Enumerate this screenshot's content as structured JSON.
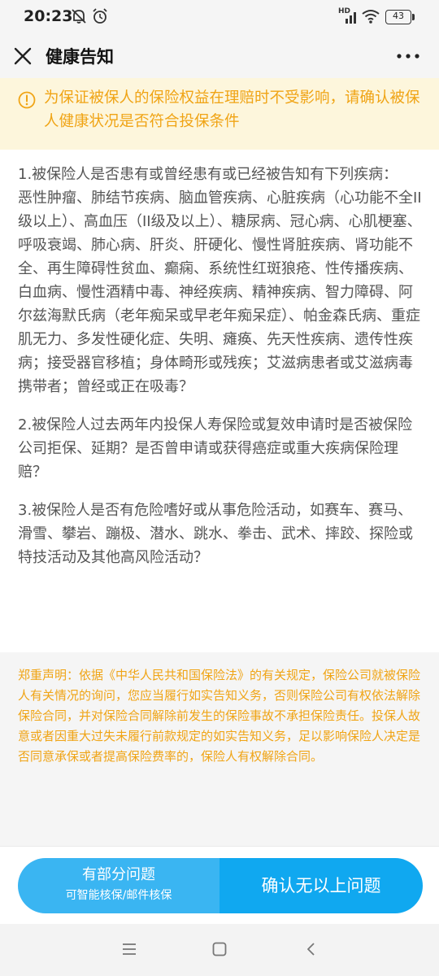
{
  "status_bar": {
    "time": "20:23",
    "network": "HD",
    "battery": "43",
    "icons": [
      "mute-bell-icon",
      "alarm-icon",
      "signal-icon",
      "wifi-icon",
      "battery-icon"
    ]
  },
  "title_bar": {
    "title": "健康告知",
    "close_icon": "close-icon",
    "more_icon": "more-icon"
  },
  "warning": {
    "icon": "warning-icon",
    "text": "为保证被保人的保险权益在理赔时不受影响，请确认被保人健康状况是否符合投保条件"
  },
  "questions": [
    {
      "title": "1.被保险人是否患有或曾经患有或已经被告知有下列疾病：",
      "body": "恶性肿瘤、肺结节疾病、脑血管疾病、心脏疾病（心功能不全II级以上）、高血压（II级及以上）、糖尿病、冠心病、心肌梗塞、呼吸衰竭、肺心病、肝炎、肝硬化、慢性肾脏疾病、肾功能不全、再生障碍性贫血、癫痫、系统性红斑狼疮、性传播疾病、白血病、慢性酒精中毒、神经疾病、精神疾病、智力障碍、阿尔兹海默氏病（老年痴呆或早老年痴呆症）、帕金森氏病、重症肌无力、多发性硬化症、失明、瘫痪、先天性疾病、遗传性疾病；接受器官移植；身体畸形或残疾；艾滋病患者或艾滋病毒携带者；曾经或正在吸毒？"
    },
    {
      "title": "2.被保险人过去两年内投保人寿保险或复效申请时是否被保险公司拒保、延期？是否曾申请或获得癌症或重大疾病保险理赔？",
      "body": ""
    },
    {
      "title": "3.被保险人是否有危险嗜好或从事危险活动，如赛车、赛马、滑雪、攀岩、蹦极、潜水、跳水、拳击、武术、摔跤、探险或特技活动及其他高风险活动？",
      "body": ""
    }
  ],
  "declaration": "郑重声明：依据《中华人民共和国保险法》的有关规定，保险公司就被保险人有关情况的询问，您应当履行如实告知义务，否则保险公司有权依法解除保险合同，并对保险合同解除前发生的保险事故不承担保险责任。投保人故意或者因重大过失未履行前款规定的如实告知义务，足以影响保险人决定是否同意承保或者提高保险费率的，保险人有权解除合同。",
  "actions": {
    "partial_label": "有部分问题",
    "partial_sublabel": "可智能核保/邮件核保",
    "confirm_label": "确认无以上问题"
  },
  "nav_bar": {
    "icons": [
      "menu-icon",
      "home-icon",
      "back-icon"
    ]
  },
  "colors": {
    "accent_orange": "#f0a415",
    "banner_bg": "#fdf6dc",
    "button_light_blue": "#3ab5f2",
    "button_blue": "#10a8f0"
  }
}
